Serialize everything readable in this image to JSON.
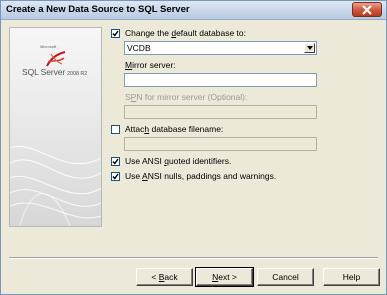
{
  "window": {
    "title": "Create a New Data Source to SQL Server"
  },
  "logo": {
    "small_text": "Microsoft",
    "product": "SQL Server",
    "version": "2008 R2"
  },
  "form": {
    "change_db": {
      "checked": true,
      "label_pre": "Change the ",
      "label_key": "d",
      "label_post": "efault database to:",
      "value": "VCDB"
    },
    "mirror": {
      "label_key": "M",
      "label_post": "irror server:",
      "value": ""
    },
    "spn": {
      "label_pre": "S",
      "label_key": "P",
      "label_post": "N for mirror server (Optional):",
      "value": ""
    },
    "attach": {
      "checked": false,
      "label_pre": "Attac",
      "label_key": "h",
      "label_post": " database filename:",
      "value": ""
    },
    "ansi_quoted": {
      "checked": true,
      "label_pre": "Use ANSI ",
      "label_key": "q",
      "label_post": "uoted identifiers."
    },
    "ansi_nulls": {
      "checked": true,
      "label_pre": "Use ",
      "label_key": "A",
      "label_post": "NSI nulls, paddings and warnings."
    }
  },
  "buttons": {
    "back": {
      "arrow": "<",
      "key": "B",
      "post": "ack"
    },
    "next": {
      "key": "N",
      "post": "ext >"
    },
    "cancel": {
      "label": "Cancel"
    },
    "help": {
      "label": "Help"
    }
  }
}
